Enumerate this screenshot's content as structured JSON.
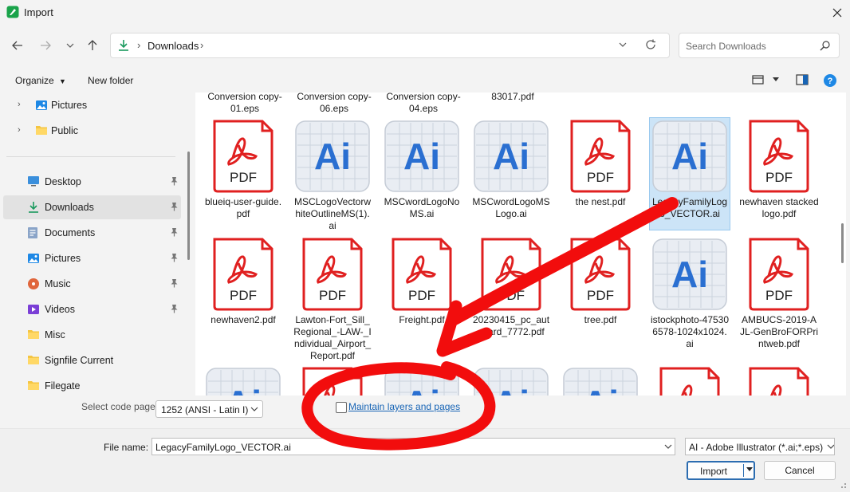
{
  "window": {
    "title": "Import",
    "accent": "#2a6fd1"
  },
  "nav": {
    "address_folder": "Downloads",
    "search_placeholder": "Search Downloads"
  },
  "toolbar": {
    "organize_label": "Organize",
    "new_folder_label": "New folder"
  },
  "sidebar": {
    "top_items": [
      {
        "label": "Pictures",
        "icon": "pictures-icon"
      },
      {
        "label": "Public",
        "icon": "folder-icon"
      }
    ],
    "quick_access": [
      {
        "label": "Desktop",
        "icon": "desktop-icon",
        "pinned": true
      },
      {
        "label": "Downloads",
        "icon": "download-icon",
        "pinned": true,
        "selected": true
      },
      {
        "label": "Documents",
        "icon": "documents-icon",
        "pinned": true
      },
      {
        "label": "Pictures",
        "icon": "pictures-icon",
        "pinned": true
      },
      {
        "label": "Music",
        "icon": "music-icon",
        "pinned": true
      },
      {
        "label": "Videos",
        "icon": "videos-icon",
        "pinned": true
      },
      {
        "label": "Misc",
        "icon": "folder-icon",
        "pinned": false
      },
      {
        "label": "Signfile Current",
        "icon": "folder-icon",
        "pinned": false
      },
      {
        "label": "Filegate",
        "icon": "folder-icon",
        "pinned": false
      }
    ]
  },
  "files": {
    "top_partial": [
      "Conversion copy-01.eps",
      "Conversion copy-06.eps",
      "Conversion copy-04.eps",
      "83017.pdf"
    ],
    "row1": [
      {
        "name": "blueiq-user-guide.pdf",
        "type": "pdf"
      },
      {
        "name": "MSCLogoVectorwhiteOutlineMS(1).ai",
        "type": "ai"
      },
      {
        "name": "MSCwordLogoNoMS.ai",
        "type": "ai"
      },
      {
        "name": "MSCwordLogoMSLogo.ai",
        "type": "ai"
      },
      {
        "name": "the nest.pdf",
        "type": "pdf"
      },
      {
        "name": "LegacyFamilyLogo_VECTOR.ai",
        "type": "ai",
        "selected": true
      },
      {
        "name": "newhaven stacked logo.pdf",
        "type": "pdf"
      }
    ],
    "row2": [
      {
        "name": "newhaven2.pdf",
        "type": "pdf"
      },
      {
        "name": "Lawton-Fort_Sill_Regional_-LAW-_Individual_Airport_Report.pdf",
        "type": "pdf"
      },
      {
        "name": "Freight.pdf",
        "type": "pdf"
      },
      {
        "name": "20230415_pc_autocard_7772.pdf",
        "type": "pdf"
      },
      {
        "name": "tree.pdf",
        "type": "pdf"
      },
      {
        "name": "istockphoto-475306578-1024x1024.ai",
        "type": "ai"
      },
      {
        "name": "AMBUCS-2019-AJL-GenBroFORPrintweb.pdf",
        "type": "pdf"
      }
    ],
    "row3_types": [
      "ai",
      "pdf",
      "ai",
      "ai",
      "ai",
      "pdf",
      "pdf"
    ],
    "pdf_badge": "PDF",
    "ai_badge": "Ai"
  },
  "options": {
    "code_page_label": "Select code page",
    "code_page_value": "1252  (ANSI - Latin I)",
    "maintain_label": "Maintain layers and pages",
    "maintain_checked": false
  },
  "bottom": {
    "file_name_label": "File name:",
    "file_name_value": "LegacyFamilyLogo_VECTOR.ai",
    "file_type_value": "AI - Adobe Illustrator (*.ai;*.eps)",
    "import_label": "Import",
    "cancel_label": "Cancel"
  },
  "annotation": {
    "color": "#f20d0d",
    "shapes": [
      "arrow",
      "circle"
    ]
  }
}
